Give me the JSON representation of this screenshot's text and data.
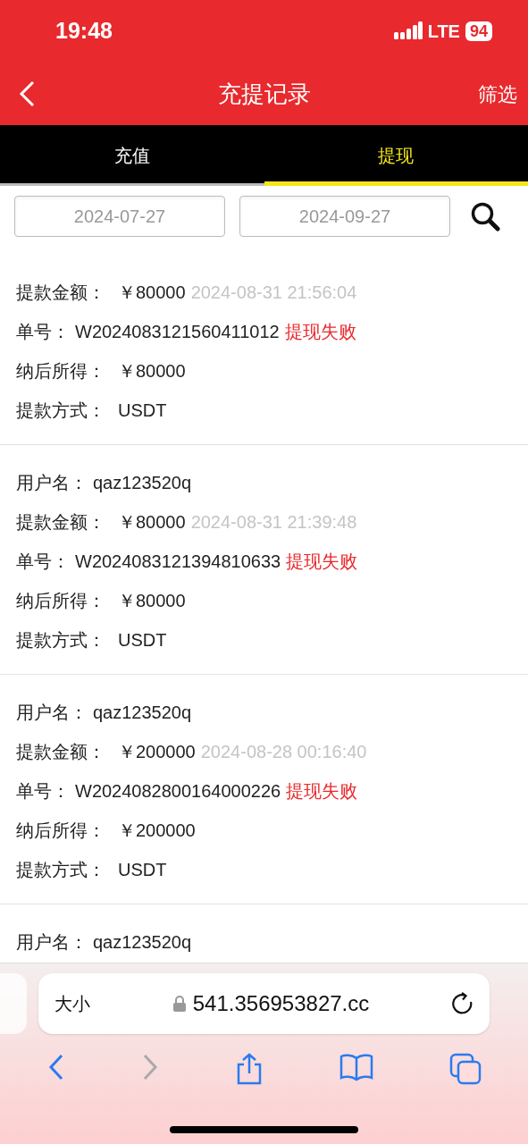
{
  "status_bar": {
    "time": "19:48",
    "network": "LTE",
    "battery": "94"
  },
  "nav": {
    "title": "充提记录",
    "action": "筛选"
  },
  "tabs": [
    {
      "label": "充值",
      "selected": false
    },
    {
      "label": "提现",
      "selected": true
    }
  ],
  "date_range": {
    "start": "2024-07-27",
    "end": "2024-09-27"
  },
  "records": [
    {
      "amount_label": "提款金额：",
      "amount": "￥80000",
      "time": "2024-08-31 21:56:04",
      "order_label": "单号：",
      "order_no": "W2024083121560411012",
      "status": "提现失败",
      "net_label": "纳后所得：",
      "net": "￥80000",
      "method_label": "提款方式：",
      "method": "USDT"
    },
    {
      "username_label": "用户名：",
      "username": "qaz123520q",
      "amount_label": "提款金额：",
      "amount": "￥80000",
      "time": "2024-08-31 21:39:48",
      "order_label": "单号：",
      "order_no": "W2024083121394810633",
      "status": "提现失败",
      "net_label": "纳后所得：",
      "net": "￥80000",
      "method_label": "提款方式：",
      "method": "USDT"
    },
    {
      "username_label": "用户名：",
      "username": "qaz123520q",
      "amount_label": "提款金额：",
      "amount": "￥200000",
      "time": "2024-08-28 00:16:40",
      "order_label": "单号：",
      "order_no": "W2024082800164000226",
      "status": "提现失败",
      "net_label": "纳后所得：",
      "net": "￥200000",
      "method_label": "提款方式：",
      "method": "USDT"
    },
    {
      "username_label": "用户名：",
      "username": "qaz123520q"
    }
  ],
  "browser": {
    "text_size": "大小",
    "url": "541.356953827.cc"
  }
}
